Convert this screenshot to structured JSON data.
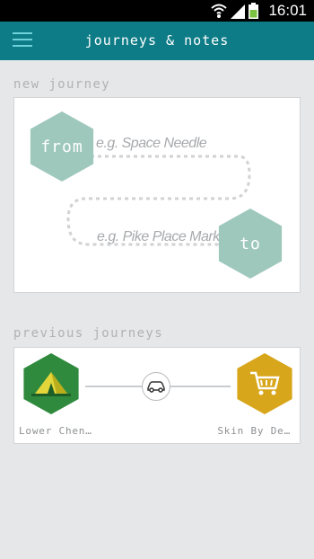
{
  "status_bar": {
    "time": "16:01"
  },
  "app_bar": {
    "title": "journeys & notes"
  },
  "new_journey": {
    "section_label": "new journey",
    "from_label": "from",
    "to_label": "to",
    "from_placeholder": "e.g. Space Needle",
    "to_placeholder": "e.g. Pike Place Market"
  },
  "previous_journeys": {
    "section_label": "previous journeys",
    "items": [
      {
        "start_name": "Lower Chen…",
        "end_name": "Skin By De…",
        "start_icon": "tent-icon",
        "end_icon": "shopping-cart-icon",
        "mode_icon": "car-icon"
      }
    ]
  },
  "colors": {
    "appbar": "#0e7c86",
    "hex_teal": "#9fc8bd",
    "start_green": "#2f8a3e",
    "end_gold": "#d8a61a"
  }
}
